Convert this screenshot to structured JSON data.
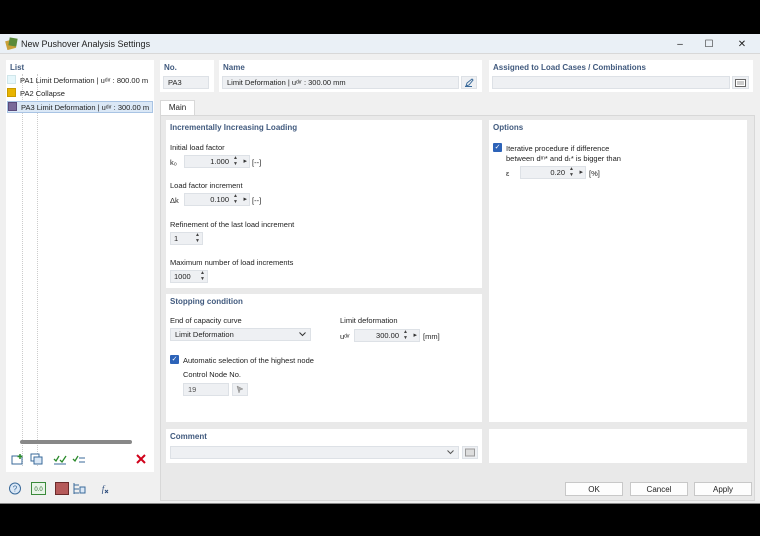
{
  "window": {
    "title": "New Pushover Analysis Settings",
    "minimize": "–",
    "maximize": "☐",
    "close": "✕"
  },
  "list": {
    "header": "List",
    "items": [
      {
        "code": "PA1",
        "name": "Limit Deformation | uᵈᶦʳ : 800.00 m",
        "color": "#e6f7fb"
      },
      {
        "code": "PA2",
        "name": "Collapse",
        "color": "#e8b400"
      },
      {
        "code": "PA3",
        "name": "Limit Deformation | uᵈᶦʳ : 300.00 m",
        "color": "#7a6a9a"
      }
    ]
  },
  "no": {
    "label": "No.",
    "value": "PA3"
  },
  "name": {
    "label": "Name",
    "value": "Limit Deformation | uᵈᶦʳ : 300.00 mm"
  },
  "assigned": {
    "label": "Assigned to Load Cases / Combinations",
    "value": ""
  },
  "tabs": [
    {
      "label": "Main"
    }
  ],
  "loading": {
    "title": "Incrementally Increasing Loading",
    "initial_label": "Initial load factor",
    "initial_sym": "k₀",
    "initial_value": "1.000",
    "initial_unit": "[--]",
    "increment_label": "Load factor increment",
    "increment_sym": "Δk",
    "increment_value": "0.100",
    "increment_unit": "[--]",
    "refine_label": "Refinement of the last load increment",
    "refine_value": "1",
    "max_label": "Maximum number of load increments",
    "max_value": "1000"
  },
  "options": {
    "title": "Options",
    "iter_line1": "Iterative procedure if difference",
    "iter_line2": "between dᵐ* and dₜ* is bigger than",
    "eps_sym": "ε",
    "eps_value": "0.20",
    "eps_unit": "[%]"
  },
  "stopping": {
    "title": "Stopping condition",
    "end_label": "End of capacity curve",
    "end_value": "Limit Deformation",
    "limit_label": "Limit deformation",
    "limit_sym": "uᵈᶦʳ",
    "limit_value": "300.00",
    "limit_unit": "[mm]",
    "auto_label": "Automatic selection of the highest node",
    "control_label": "Control Node No.",
    "control_value": "19"
  },
  "comment": {
    "label": "Comment",
    "value": ""
  },
  "buttons": {
    "ok": "OK",
    "cancel": "Cancel",
    "apply": "Apply"
  },
  "checkmark": "✓",
  "colors": {
    "accent": "#2d63b8",
    "header": "#415a7e",
    "delete": "#d0021b"
  }
}
